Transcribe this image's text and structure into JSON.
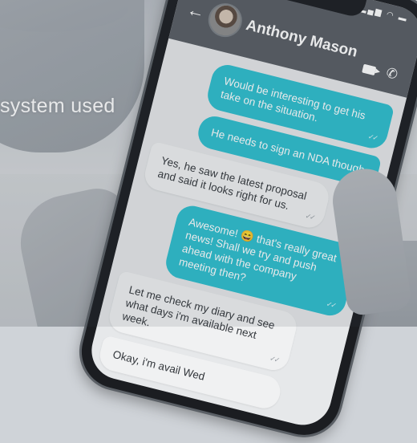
{
  "background": {
    "caption": "system used"
  },
  "app": {
    "contact_name": "Anthony Mason",
    "back_icon": "arrow-left-icon",
    "video_icon": "video-camera-icon",
    "call_icon": "phone-icon",
    "accent_color": "#2dbfcf",
    "header_color": "#585d63"
  },
  "messages": [
    {
      "direction": "out",
      "text": "Would be interesting to get his take on the situation."
    },
    {
      "direction": "out",
      "text": "He needs to sign an NDA though"
    },
    {
      "direction": "in",
      "text": "Yes, he saw the latest proposal and said it looks right for us."
    },
    {
      "direction": "out",
      "text": "Awesome! 😄 that's really great news! Shall we try and push ahead with the company meeting then?"
    },
    {
      "direction": "in",
      "text": "Let me check my diary and see what days i'm available next week."
    },
    {
      "direction": "in",
      "text": "Okay, i'm avail Wed"
    }
  ]
}
